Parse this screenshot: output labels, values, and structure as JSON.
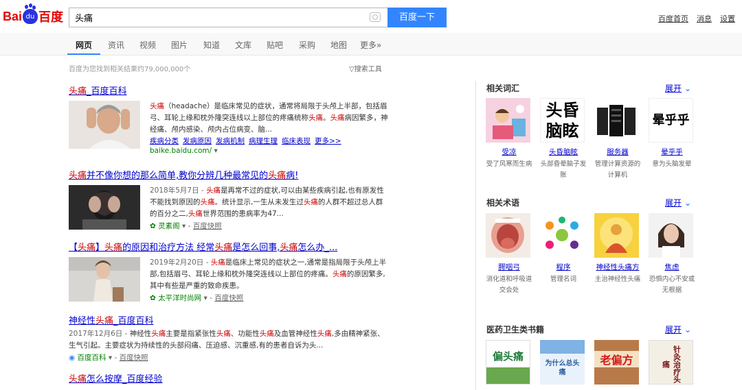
{
  "header": {
    "logo_text": "Bai百度",
    "search_value": "头痛",
    "search_button": "百度一下",
    "links": [
      "百度首页",
      "消息",
      "设置"
    ]
  },
  "nav": {
    "tabs": [
      "网页",
      "资讯",
      "视频",
      "图片",
      "知道",
      "文库",
      "贴吧",
      "采购",
      "地图",
      "更多»"
    ]
  },
  "stats": "百度为您找到相关结果约79,000,000个",
  "search_tools": "搜索工具",
  "results": [
    {
      "title_parts": [
        "头痛",
        "_百度百科"
      ],
      "text": "（headache）是临床常见的症状，通常将局限于头颅上半部，包括眉弓、耳轮上缘和枕外隆突连线以上部位的疼痛统称头痛。头痛病因繁多，神经痛、颅内感染、颅内占位病变、脑...",
      "text_lead": "头痛",
      "links": [
        "疾病分类",
        "发病原因",
        "发病机制",
        "病理生理",
        "临床表现",
        "更多>>"
      ],
      "source": "baike.baidu.com/"
    },
    {
      "title": "头痛并不像你想的那么简单,教你分辨几种最常见的头痛病!",
      "date": "2018年5月7日 -",
      "text": "头痛是再常不过的症状,可以由某些疾病引起,也有原发性不能找到原因的头痛。统计显示,一生从未发生过头痛的人群不超过总人群的百分之二,头痛世界范围的患病率为47...",
      "source": "灵素阁",
      "kuaizhao": "百度快照"
    },
    {
      "title": "【头痛】头痛的原因和治疗方法 经常头痛是怎么回事,头痛怎么办_...",
      "date": "2019年2月20日 -",
      "text": "头痛是临床上常见的症状之一,通常是指局限于头颅上半部,包括眉弓、耳轮上缘和枕外隆突连线以上部位的疼痛。头痛的原因繁多,其中有些是严重的致命疾患。",
      "source": "太平洋时尚网",
      "kuaizhao": "百度快照"
    },
    {
      "title": "神经性头痛_百度百科",
      "date": "2017年12月6日 -",
      "text": "神经性头痛主要是指紧张性头痛、功能性头痛及血管神经性头痛,多由精神紧张、生气引起。主要症状为持续性的头部闷痛、压迫感、沉重感,有的患者自诉为头...",
      "source": "百度百科",
      "kuaizhao": "百度快照"
    },
    {
      "title": "头痛怎么按摩_百度经验"
    }
  ],
  "sidebar": {
    "more_label": "展开",
    "sections": [
      {
        "heading": "相关词汇",
        "cards": [
          {
            "name": "受凉",
            "desc": "受了风寒而生病",
            "icon": "cold-illustration"
          },
          {
            "name": "头昏脑眩",
            "desc": "头部昏晕脑子发胀",
            "icon": "text-image",
            "img_text": "头昏脑眩"
          },
          {
            "name": "服务器",
            "desc": "管理计算资源的计算机",
            "icon": "server-rack"
          },
          {
            "name": "晕乎乎",
            "desc": "意为头脑发晕",
            "icon": "text-image",
            "img_text": "晕乎乎"
          }
        ]
      },
      {
        "heading": "相关术语",
        "cards": [
          {
            "name": "腭咽弓",
            "desc": "消化道和呼吸道交会处",
            "icon": "mouth-anatomy"
          },
          {
            "name": "程序",
            "desc": "管理名词",
            "icon": "process-diagram"
          },
          {
            "name": "神经性头痛方",
            "desc": "主治神经性头痛",
            "icon": "buddha"
          },
          {
            "name": "焦虑",
            "desc": "恐惧内心不安或无根据",
            "icon": "anxious-woman"
          }
        ]
      },
      {
        "heading": "医药卫生类书籍",
        "cards": [
          {
            "name": "",
            "desc": "",
            "icon": "book-cover",
            "img_text": "偏头痛"
          },
          {
            "name": "",
            "desc": "",
            "icon": "book-cover",
            "img_text": "为什么总头痛"
          },
          {
            "name": "",
            "desc": "",
            "icon": "book-cover",
            "img_text": "老偏方"
          },
          {
            "name": "",
            "desc": "",
            "icon": "book-cover",
            "img_text": "针灸治疗头痛"
          }
        ]
      }
    ]
  },
  "colors": {
    "link_blue": "#0000cc",
    "highlight_red": "#cc0000",
    "button_blue": "#3385ff",
    "source_green": "#008000"
  }
}
